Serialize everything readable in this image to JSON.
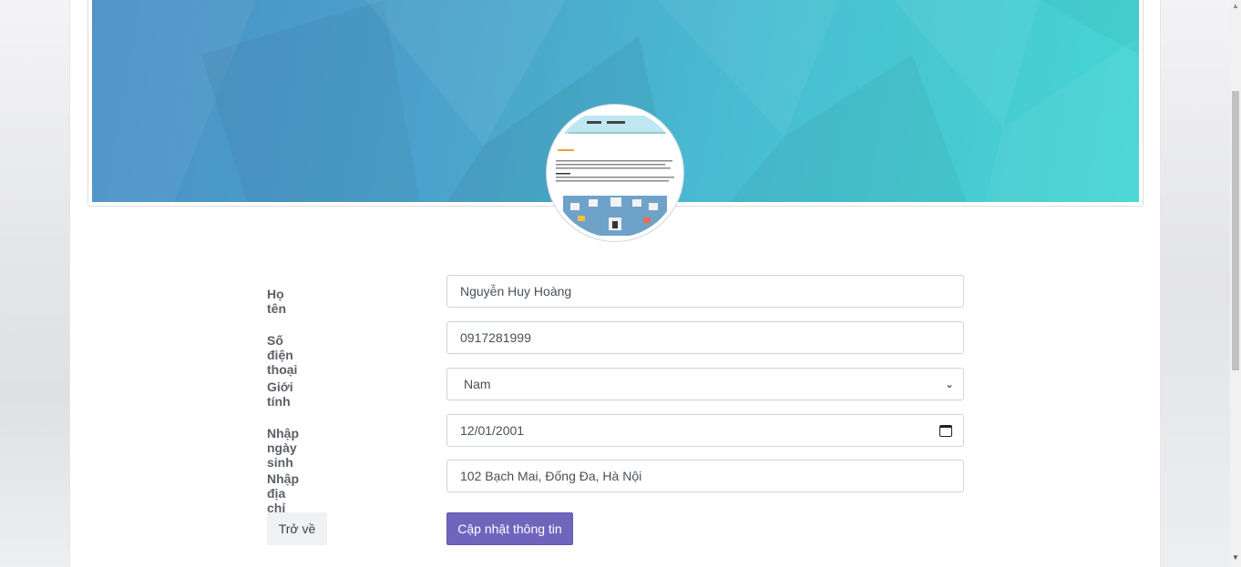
{
  "profile": {
    "avatar_alt": "avatar"
  },
  "form": {
    "fullname": {
      "label": "Họ tên",
      "value": "Nguyễn Huy Hoàng"
    },
    "phone": {
      "label": "Số điện thoại",
      "value": "0917281999"
    },
    "gender": {
      "label": "Giới tính",
      "value": "Nam"
    },
    "birthday": {
      "label": "Nhập ngày sinh",
      "value": "12/01/2001"
    },
    "address": {
      "label": "Nhập địa chỉ",
      "value": "102 Bạch Mai, Đống Đa, Hà Nội"
    }
  },
  "buttons": {
    "back": "Trở về",
    "update": "Cập nhật thông tin"
  },
  "colors": {
    "cover_start": "#4a90c6",
    "cover_end": "#45d6d2",
    "primary_button": "#7164bd"
  }
}
